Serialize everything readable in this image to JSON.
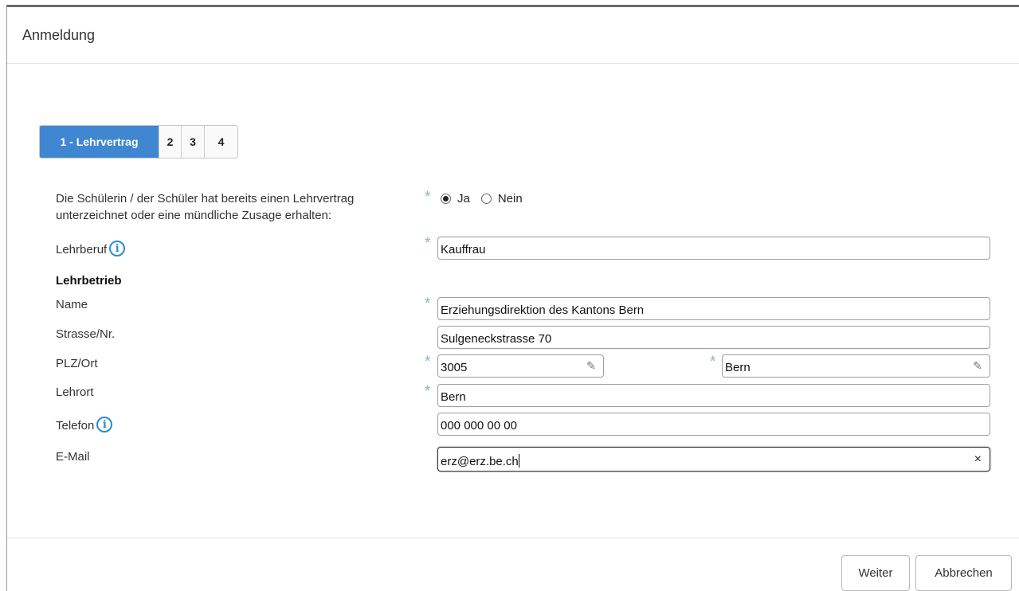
{
  "dialog": {
    "title": "Anmeldung"
  },
  "steps": [
    {
      "label": "1 - Lehrvertrag",
      "active": true
    },
    {
      "label": "2"
    },
    {
      "label": "3"
    },
    {
      "label": "4"
    }
  ],
  "question": {
    "line1": "Die Schülerin / der Schüler hat bereits einen Lehrvertrag",
    "line2": "unterzeichnet oder eine mündliche Zusage erhalten:",
    "options": [
      "Ja",
      "Nein"
    ],
    "selected": "Ja"
  },
  "fields": {
    "lehrberuf": {
      "label": "Lehrberuf",
      "value": "Kauffrau"
    },
    "section": "Lehrbetrieb",
    "name": {
      "label": "Name",
      "value": "Erziehungsdirektion des Kantons Bern"
    },
    "strasse": {
      "label": "Strasse/Nr.",
      "value": "Sulgeneckstrasse 70"
    },
    "plzort": {
      "label": "PLZ/Ort",
      "plz": "3005",
      "ort": "Bern"
    },
    "lehrort": {
      "label": "Lehrort",
      "value": "Bern"
    },
    "telefon": {
      "label": "Telefon",
      "value": "000 000 00 00"
    },
    "email": {
      "label": "E-Mail",
      "value": "erz@erz.be.ch"
    }
  },
  "required_marker": "*",
  "info_glyph": "i",
  "clear_glyph": "×",
  "pencil_glyph": "✎",
  "buttons": {
    "next": "Weiter",
    "cancel": "Abbrechen"
  },
  "colors": {
    "accent": "#3f87d1",
    "info": "#2a8bd0",
    "required": "#8bb0d3"
  }
}
